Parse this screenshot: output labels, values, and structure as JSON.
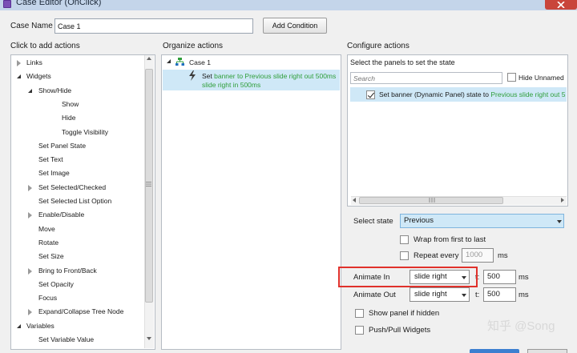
{
  "window": {
    "title": "Case Editor (OnClick)"
  },
  "top": {
    "case_name_label": "Case Name",
    "case_name_value": "Case 1",
    "add_condition_label": "Add Condition"
  },
  "left": {
    "header": "Click to add actions",
    "items": [
      {
        "label": "Links",
        "expander": "collapsed",
        "indent": 0
      },
      {
        "label": "Widgets",
        "expander": "expanded",
        "indent": 0
      },
      {
        "label": "Show/Hide",
        "expander": "expanded",
        "indent": 1
      },
      {
        "label": "Show",
        "expander": "none",
        "indent": 2
      },
      {
        "label": "Hide",
        "expander": "none",
        "indent": 2
      },
      {
        "label": "Toggle Visibility",
        "expander": "none",
        "indent": 2
      },
      {
        "label": "Set Panel State",
        "expander": "none",
        "indent": 1
      },
      {
        "label": "Set Text",
        "expander": "none",
        "indent": 1
      },
      {
        "label": "Set Image",
        "expander": "none",
        "indent": 1
      },
      {
        "label": "Set Selected/Checked",
        "expander": "collapsed",
        "indent": 1
      },
      {
        "label": "Set Selected List Option",
        "expander": "none",
        "indent": 1
      },
      {
        "label": "Enable/Disable",
        "expander": "collapsed",
        "indent": 1
      },
      {
        "label": "Move",
        "expander": "none",
        "indent": 1
      },
      {
        "label": "Rotate",
        "expander": "none",
        "indent": 1
      },
      {
        "label": "Set Size",
        "expander": "none",
        "indent": 1
      },
      {
        "label": "Bring to Front/Back",
        "expander": "collapsed",
        "indent": 1
      },
      {
        "label": "Set Opacity",
        "expander": "none",
        "indent": 1
      },
      {
        "label": "Focus",
        "expander": "none",
        "indent": 1
      },
      {
        "label": "Expand/Collapse Tree Node",
        "expander": "collapsed",
        "indent": 1
      },
      {
        "label": "Variables",
        "expander": "expanded",
        "indent": 0
      },
      {
        "label": "Set Variable Value",
        "expander": "none",
        "indent": 1
      }
    ]
  },
  "middle": {
    "header": "Organize actions",
    "case_label": "Case 1",
    "action_prefix": "Set ",
    "action_line1": "banner to Previous slide right out 500ms",
    "action_line2": "slide right in 500ms"
  },
  "right": {
    "header": "Configure actions",
    "panels_label": "Select the panels to set the state",
    "search_placeholder": "Search",
    "hide_unnamed_label": "Hide Unnamed",
    "panel_item_prefix": "Set banner (Dynamic Panel) state to ",
    "panel_item_state": "Previous slide right out 5",
    "select_state_label": "Select state",
    "select_state_value": "Previous",
    "wrap_label": "Wrap from first to last",
    "repeat_label": "Repeat every",
    "repeat_value": "1000",
    "repeat_unit": "ms",
    "animate_in_label": "Animate In",
    "animate_in_value": "slide right",
    "animate_in_t_label": "t:",
    "animate_in_t_value": "500",
    "animate_in_unit": "ms",
    "animate_out_label": "Animate Out",
    "animate_out_value": "slide right",
    "animate_out_t_label": "t:",
    "animate_out_t_value": "500",
    "animate_out_unit": "ms",
    "show_if_hidden_label": "Show panel if hidden",
    "push_pull_label": "Push/Pull Widgets"
  },
  "watermark": "知乎 @Song",
  "colors": {
    "selection": "#cfe8f7",
    "highlight": "#e0312b",
    "action_text": "#2f9e3a"
  }
}
